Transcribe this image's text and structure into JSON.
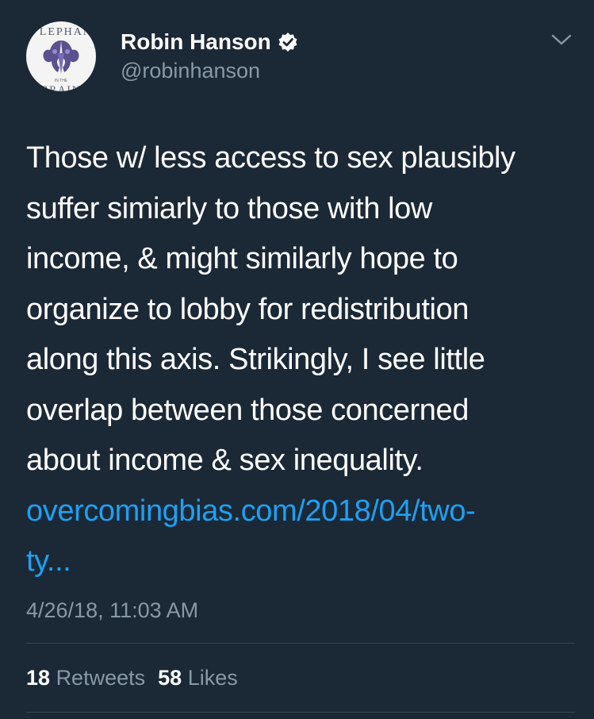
{
  "tweet": {
    "author": {
      "display_name": "Robin Hanson",
      "handle": "@robinhanson",
      "verified": true,
      "avatar": {
        "top_text": "LEPHAN",
        "middle_text": "IN THE",
        "bottom_text": "BRAIN"
      }
    },
    "text_lines": [
      "Those w/ less access to sex plausibly",
      "suffer simiarly to those with low",
      "income, & might similarly hope to",
      "organize to lobby for redistribution",
      "along this axis. Strikingly, I see little",
      "overlap between those concerned",
      "about income & sex inequality."
    ],
    "link_lines": [
      "overcomingbias.com/2018/04/two-",
      "ty..."
    ],
    "timestamp": "4/26/18, 11:03 AM",
    "stats": {
      "retweets_count": "18",
      "retweets_label": "Retweets",
      "likes_count": "58",
      "likes_label": "Likes"
    },
    "icons": {
      "verified": "verified-badge-icon",
      "menu": "chevron-down-icon"
    },
    "colors": {
      "background": "#1b2836",
      "link": "#1da1f2",
      "secondary_text": "#8899a6",
      "divider": "#38444d"
    }
  }
}
